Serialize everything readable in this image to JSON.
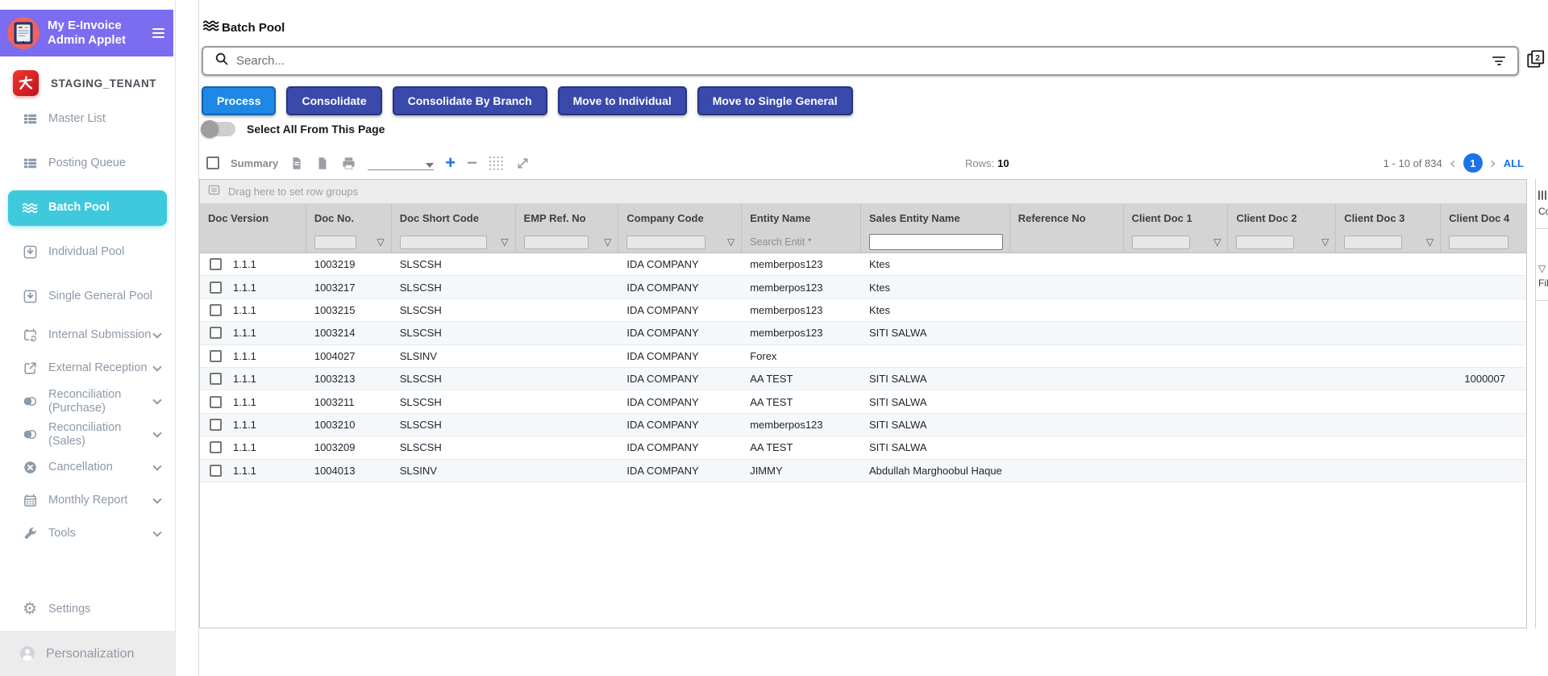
{
  "colors": {
    "purple": "#7b6cf0",
    "cyan_active": "#3ec9dd",
    "primary_blue": "#1e88e5",
    "navy": "#3a49ac",
    "link_blue": "#1a73e8",
    "tenant_red": "#d61f26"
  },
  "icons": [
    "invoice-app-icon",
    "hamburger-icon",
    "tenant-logo-icon",
    "list-icon",
    "waves-icon",
    "box-download-icon",
    "calendar-refresh-icon",
    "external-link-icon",
    "venn-icon",
    "cancel-icon",
    "calendar-icon",
    "wrench-icon",
    "gear-icon",
    "person-icon",
    "search-icon",
    "filter-lines-icon",
    "pages-2-icon",
    "summary-doc-icon",
    "blank-doc-icon",
    "print-icon",
    "plus-icon",
    "minus-icon",
    "grid-density-icon",
    "expand-icon",
    "row-groups-icon",
    "funnel-icon",
    "columns-bars-icon"
  ],
  "sidebar": {
    "app_title": "My E-Invoice Admin Applet",
    "tenant": "STAGING_TENANT",
    "items": [
      {
        "label": "Master List",
        "icon": "list"
      },
      {
        "label": "Posting Queue",
        "icon": "list"
      },
      {
        "label": "Batch Pool",
        "icon": "waves",
        "active": true
      },
      {
        "label": "Individual Pool",
        "icon": "box-down"
      },
      {
        "label": "Single General Pool",
        "icon": "box-down"
      },
      {
        "label": "Internal Submission",
        "icon": "calendar-refresh",
        "expandable": true
      },
      {
        "label": "External Reception",
        "icon": "external",
        "expandable": true
      },
      {
        "label": "Reconciliation (Purchase)",
        "icon": "venn",
        "expandable": true
      },
      {
        "label": "Reconciliation (Sales)",
        "icon": "venn",
        "expandable": true
      },
      {
        "label": "Cancellation",
        "icon": "cancel",
        "expandable": true
      },
      {
        "label": "Monthly Report",
        "icon": "calendar",
        "expandable": true
      },
      {
        "label": "Tools",
        "icon": "wrench",
        "expandable": true
      }
    ],
    "footer": {
      "settings_label": "Settings",
      "personalization_label": "Personalization"
    }
  },
  "main": {
    "page_title": "Batch Pool",
    "search_placeholder": "Search...",
    "windows_count": "2",
    "actions": [
      "Process",
      "Consolidate",
      "Consolidate By Branch",
      "Move to Individual",
      "Move to Single General"
    ],
    "select_all_label": "Select All From This Page",
    "toolbar": {
      "summary_label": "Summary",
      "rows_label": "Rows:",
      "rows_value": "10"
    },
    "pagination": {
      "range": "1 - 10 of 834",
      "page": "1",
      "all_label": "ALL"
    },
    "grid": {
      "drag_hint": "Drag here to set row groups",
      "columns": [
        "Doc Version",
        "Doc No.",
        "Doc Short Code",
        "EMP Ref. No",
        "Company Code",
        "Entity Name",
        "Sales Entity Name",
        "Reference No",
        "Client Doc 1",
        "Client Doc 2",
        "Client Doc 3",
        "Client Doc 4"
      ],
      "entity_filter_placeholder": "Search Entit",
      "side_panel": {
        "columns_label": "Columns",
        "filters_label": "Filters"
      },
      "rows": [
        {
          "doc_version": "1.1.1",
          "doc_no": "1003219",
          "doc_short_code": "SLSCSH",
          "emp_ref_no": "",
          "company_code": "IDA COMPANY",
          "entity_name": "memberpos123",
          "sales_entity_name": "Ktes",
          "reference_no": "",
          "client_doc_1": "",
          "client_doc_2": "",
          "client_doc_3": "",
          "client_doc_4": ""
        },
        {
          "doc_version": "1.1.1",
          "doc_no": "1003217",
          "doc_short_code": "SLSCSH",
          "emp_ref_no": "",
          "company_code": "IDA COMPANY",
          "entity_name": "memberpos123",
          "sales_entity_name": "Ktes",
          "reference_no": "",
          "client_doc_1": "",
          "client_doc_2": "",
          "client_doc_3": "",
          "client_doc_4": ""
        },
        {
          "doc_version": "1.1.1",
          "doc_no": "1003215",
          "doc_short_code": "SLSCSH",
          "emp_ref_no": "",
          "company_code": "IDA COMPANY",
          "entity_name": "memberpos123",
          "sales_entity_name": "Ktes",
          "reference_no": "",
          "client_doc_1": "",
          "client_doc_2": "",
          "client_doc_3": "",
          "client_doc_4": ""
        },
        {
          "doc_version": "1.1.1",
          "doc_no": "1003214",
          "doc_short_code": "SLSCSH",
          "emp_ref_no": "",
          "company_code": "IDA COMPANY",
          "entity_name": "memberpos123",
          "sales_entity_name": "SITI SALWA",
          "reference_no": "",
          "client_doc_1": "",
          "client_doc_2": "",
          "client_doc_3": "",
          "client_doc_4": ""
        },
        {
          "doc_version": "1.1.1",
          "doc_no": "1004027",
          "doc_short_code": "SLSINV",
          "emp_ref_no": "",
          "company_code": "IDA COMPANY",
          "entity_name": "Forex",
          "sales_entity_name": "",
          "reference_no": "",
          "client_doc_1": "",
          "client_doc_2": "",
          "client_doc_3": "",
          "client_doc_4": ""
        },
        {
          "doc_version": "1.1.1",
          "doc_no": "1003213",
          "doc_short_code": "SLSCSH",
          "emp_ref_no": "",
          "company_code": "IDA COMPANY",
          "entity_name": "AA TEST",
          "sales_entity_name": "SITI SALWA",
          "reference_no": "",
          "client_doc_1": "",
          "client_doc_2": "",
          "client_doc_3": "",
          "client_doc_4": "1000007"
        },
        {
          "doc_version": "1.1.1",
          "doc_no": "1003211",
          "doc_short_code": "SLSCSH",
          "emp_ref_no": "",
          "company_code": "IDA COMPANY",
          "entity_name": "AA TEST",
          "sales_entity_name": "SITI SALWA",
          "reference_no": "",
          "client_doc_1": "",
          "client_doc_2": "",
          "client_doc_3": "",
          "client_doc_4": ""
        },
        {
          "doc_version": "1.1.1",
          "doc_no": "1003210",
          "doc_short_code": "SLSCSH",
          "emp_ref_no": "",
          "company_code": "IDA COMPANY",
          "entity_name": "memberpos123",
          "sales_entity_name": "SITI SALWA",
          "reference_no": "",
          "client_doc_1": "",
          "client_doc_2": "",
          "client_doc_3": "",
          "client_doc_4": ""
        },
        {
          "doc_version": "1.1.1",
          "doc_no": "1003209",
          "doc_short_code": "SLSCSH",
          "emp_ref_no": "",
          "company_code": "IDA COMPANY",
          "entity_name": "AA TEST",
          "sales_entity_name": "SITI SALWA",
          "reference_no": "",
          "client_doc_1": "",
          "client_doc_2": "",
          "client_doc_3": "",
          "client_doc_4": ""
        },
        {
          "doc_version": "1.1.1",
          "doc_no": "1004013",
          "doc_short_code": "SLSINV",
          "emp_ref_no": "",
          "company_code": "IDA COMPANY",
          "entity_name": "JIMMY",
          "sales_entity_name": "Abdullah Marghoobul Haque",
          "reference_no": "",
          "client_doc_1": "",
          "client_doc_2": "",
          "client_doc_3": "",
          "client_doc_4": ""
        }
      ]
    }
  }
}
